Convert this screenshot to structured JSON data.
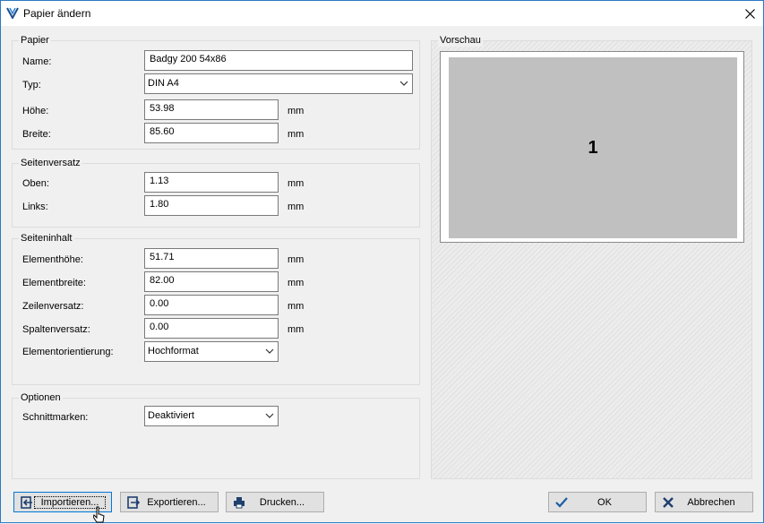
{
  "window": {
    "title": "Papier ändern"
  },
  "papier": {
    "title": "Papier",
    "name_label": "Name:",
    "name_value": "Badgy 200 54x86",
    "typ_label": "Typ:",
    "typ_value": "DIN A4",
    "hoehe_label": "Höhe:",
    "hoehe_value": "53.98",
    "hoehe_unit": "mm",
    "breite_label": "Breite:",
    "breite_value": "85.60",
    "breite_unit": "mm"
  },
  "seitenversatz": {
    "title": "Seitenversatz",
    "oben_label": "Oben:",
    "oben_value": "1.13",
    "oben_unit": "mm",
    "links_label": "Links:",
    "links_value": "1.80",
    "links_unit": "mm"
  },
  "seiteninhalt": {
    "title": "Seiteninhalt",
    "elementhoehe_label": "Elementhöhe:",
    "elementhoehe_value": "51.71",
    "elementhoehe_unit": "mm",
    "elementbreite_label": "Elementbreite:",
    "elementbreite_value": "82.00",
    "elementbreite_unit": "mm",
    "zeilenversatz_label": "Zeilenversatz:",
    "zeilenversatz_value": "0.00",
    "zeilenversatz_unit": "mm",
    "spaltenversatz_label": "Spaltenversatz:",
    "spaltenversatz_value": "0.00",
    "spaltenversatz_unit": "mm",
    "orientierung_label": "Elementorientierung:",
    "orientierung_value": "Hochformat"
  },
  "optionen": {
    "title": "Optionen",
    "schnittmarken_label": "Schnittmarken:",
    "schnittmarken_value": "Deaktiviert"
  },
  "vorschau": {
    "title": "Vorschau",
    "page_number": "1"
  },
  "buttons": {
    "importieren": "Importieren...",
    "exportieren": "Exportieren...",
    "drucken": "Drucken...",
    "ok": "OK",
    "abbrechen": "Abbrechen"
  },
  "icons": {
    "app": "app-logo-icon",
    "close": "close-icon",
    "dropdown": "chevron-down-icon",
    "import": "import-icon",
    "export": "export-icon",
    "print": "printer-icon",
    "ok": "checkmark-icon",
    "cancel": "x-icon",
    "cursor": "mouse-cursor-icon"
  },
  "colors": {
    "accent": "#0078d7",
    "preview_page": "#c0c0c0",
    "ok_check": "#1b5fa6"
  }
}
